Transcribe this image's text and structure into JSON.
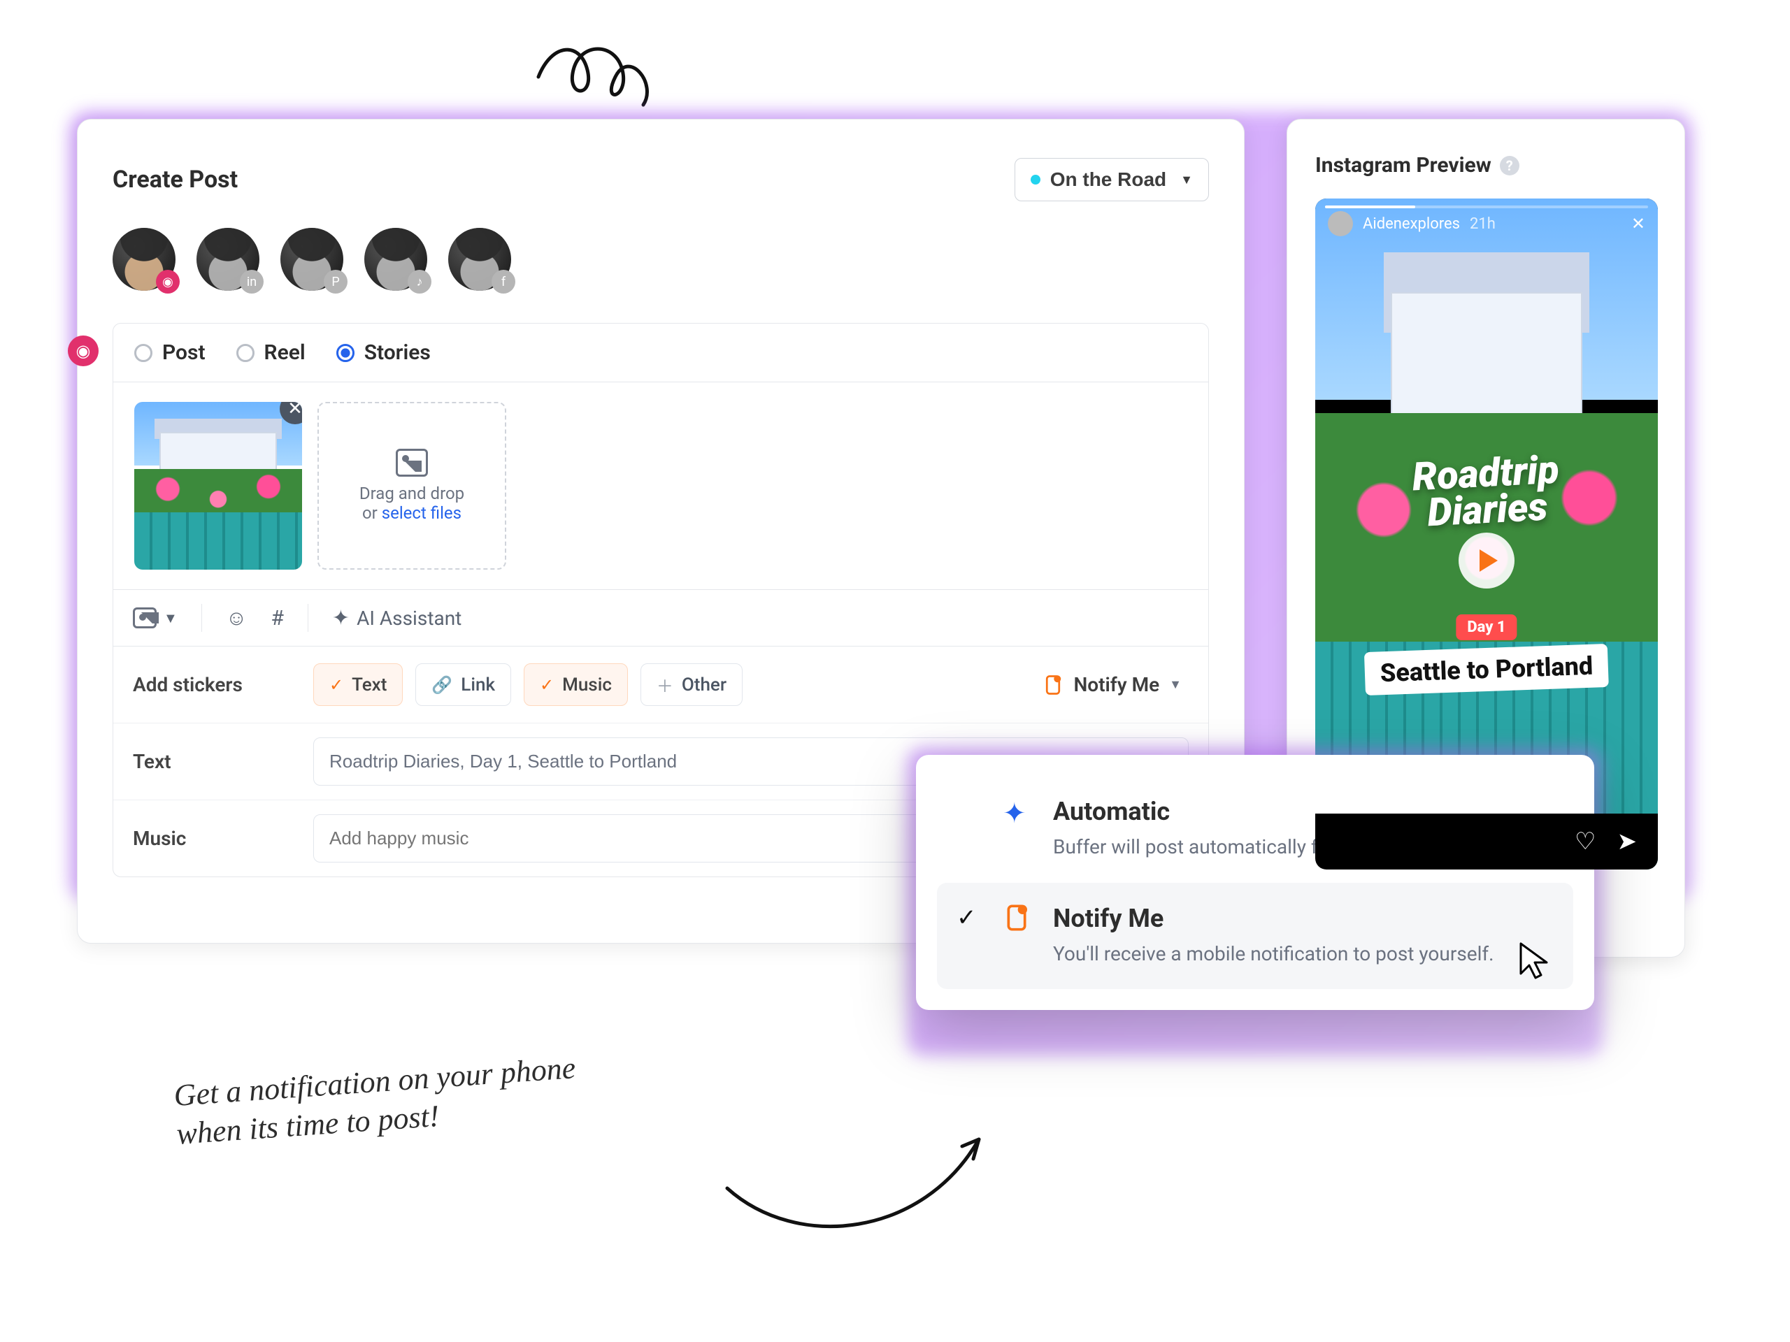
{
  "header": {
    "title": "Create Post",
    "tag": {
      "label": "On the Road"
    }
  },
  "accounts": [
    {
      "network": "instagram",
      "badge_color": "#e1306c",
      "active": true
    },
    {
      "network": "linkedin",
      "badge_color": "#b0b6bd",
      "active": false
    },
    {
      "network": "pinterest",
      "badge_color": "#b0b6bd",
      "active": false
    },
    {
      "network": "tiktok",
      "badge_color": "#b0b6bd",
      "active": false
    },
    {
      "network": "facebook",
      "badge_color": "#b0b6bd",
      "active": false
    }
  ],
  "tabs": {
    "post": "Post",
    "reel": "Reel",
    "stories": "Stories",
    "selected": "stories"
  },
  "dropzone": {
    "line1": "Drag and drop",
    "line2_prefix": "or ",
    "link": "select files"
  },
  "toolbar": {
    "ai_assistant": "AI Assistant"
  },
  "stickers": {
    "label": "Add stickers",
    "text": "Text",
    "link": "Link",
    "music": "Music",
    "other": "Other"
  },
  "notify_button": "Notify Me",
  "fields": {
    "text_label": "Text",
    "text_value": "Roadtrip Diaries, Day 1, Seattle to Portland",
    "music_label": "Music",
    "music_placeholder": "Add happy music"
  },
  "preview": {
    "title": "Instagram Preview",
    "username": "Aidenexplores",
    "age": "21h",
    "overlay_line1": "Roadtrip",
    "overlay_line2": "Diaries",
    "day_pill": "Day 1",
    "route_pill": "Seattle to Portland"
  },
  "popover": {
    "automatic_title": "Automatic",
    "automatic_desc": "Buffer will post automatically for you.",
    "notify_title": "Notify Me",
    "notify_desc": "You'll receive a mobile notification to post yourself."
  },
  "note": {
    "line1": "Get a notification on your phone",
    "line2": "when its time to post!"
  }
}
